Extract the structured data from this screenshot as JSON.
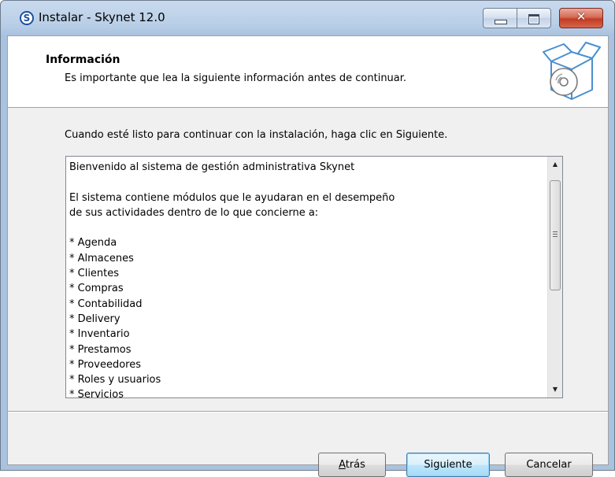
{
  "window": {
    "title": "Instalar - Skynet 12.0",
    "app_icon_letter": "S",
    "controls": {
      "minimize_icon": "minimize-icon",
      "maximize_icon": "maximize-icon",
      "close_icon": "close-icon",
      "close_glyph": "✕"
    },
    "accent_close": "#c13c24"
  },
  "header": {
    "title": "Información",
    "subtitle": "Es importante que lea la siguiente información antes de continuar.",
    "icon": "software-box-cd-icon"
  },
  "content": {
    "instruction": "Cuando esté listo para continuar con la instalación, haga clic en Siguiente.",
    "memo_lines": [
      "Bienvenido al sistema de gestión administrativa Skynet",
      "",
      "El sistema contiene módulos que le ayudaran en el desempeño",
      "de sus actividades dentro de lo que concierne a:",
      "",
      "* Agenda",
      "* Almacenes",
      "* Clientes",
      "* Compras",
      "* Contabilidad",
      "* Delivery",
      "* Inventario",
      "* Prestamos",
      "* Proveedores",
      "* Roles y usuarios",
      "* Servicios"
    ]
  },
  "buttons": {
    "back_prefix": "",
    "back_mnemonic": "A",
    "back_rest": "trás",
    "next": "Siguiente",
    "cancel": "Cancelar"
  }
}
